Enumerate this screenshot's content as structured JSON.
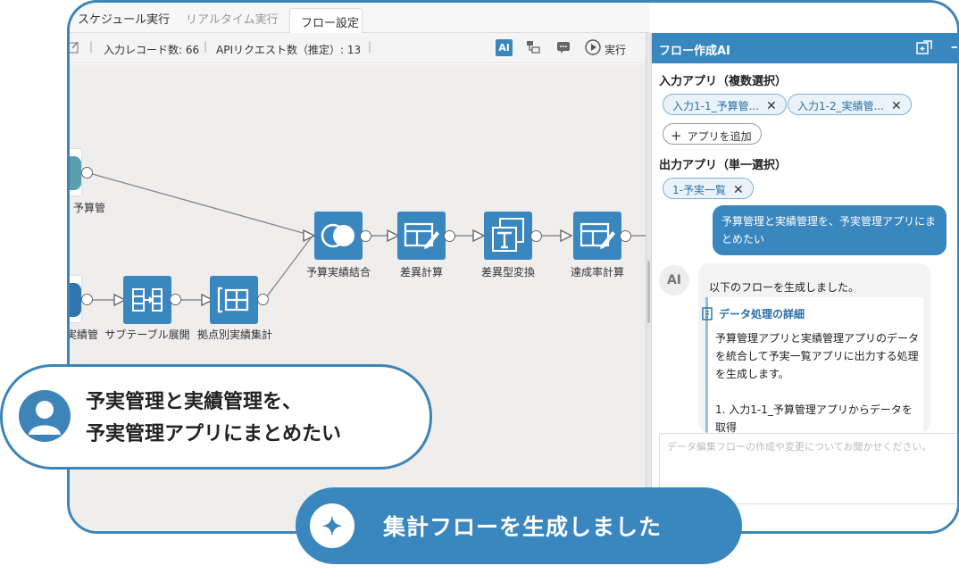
{
  "tabs": [
    {
      "label": "スケジュール実行"
    },
    {
      "label": "リアルタイム実行"
    },
    {
      "label": "フロー設定"
    }
  ],
  "toolbar": {
    "input_record_count": "入力レコード数: 66",
    "api_request_count": "APIリクエスト数（推定）: 13",
    "ai_icon_label": "AI",
    "run_label": "実行"
  },
  "flow": {
    "nodes": [
      {
        "label": "予算管"
      },
      {
        "label": "実績管"
      },
      {
        "label": "サブテーブル展開"
      },
      {
        "label": "拠点別実績集計"
      },
      {
        "label": "予算実績結合"
      },
      {
        "label": "差異計算"
      },
      {
        "label": "差異型変換"
      },
      {
        "label": "達成率計算"
      }
    ]
  },
  "panel": {
    "title": "フロー作成AI",
    "input_section": "入力アプリ（複数選択）",
    "input_chips": [
      "入力1-1_予算管...",
      "入力1-2_実績管..."
    ],
    "add_app_label": "アプリを追加",
    "output_section": "出力アプリ（単一選択）",
    "output_chips": [
      "1-予実一覧"
    ],
    "user_message": "予算管理と実績管理を、予実管理アプリにまとめたい",
    "ai_badge": "AI",
    "ai_lead": "以下のフローを生成しました。",
    "detail_title": "データ処理の詳細",
    "detail_body": "予算管理アプリと実績管理アプリのデータを統合して予実一覧アプリに出力する処理を生成します。\n\n1. 入力1-1_予算管理アプリからデータを取得",
    "prompt_placeholder": "データ編集フローの作成や変更についてお聞かせください。"
  },
  "callout": {
    "line1": "予実管理と実績管理を、",
    "line2": "予実管理アプリにまとめたい"
  },
  "banner": {
    "text": "集計フローを生成しました"
  },
  "colors": {
    "accent": "#3a87c0",
    "frame": "#3d84b8",
    "canvas": "#f0eeed"
  }
}
